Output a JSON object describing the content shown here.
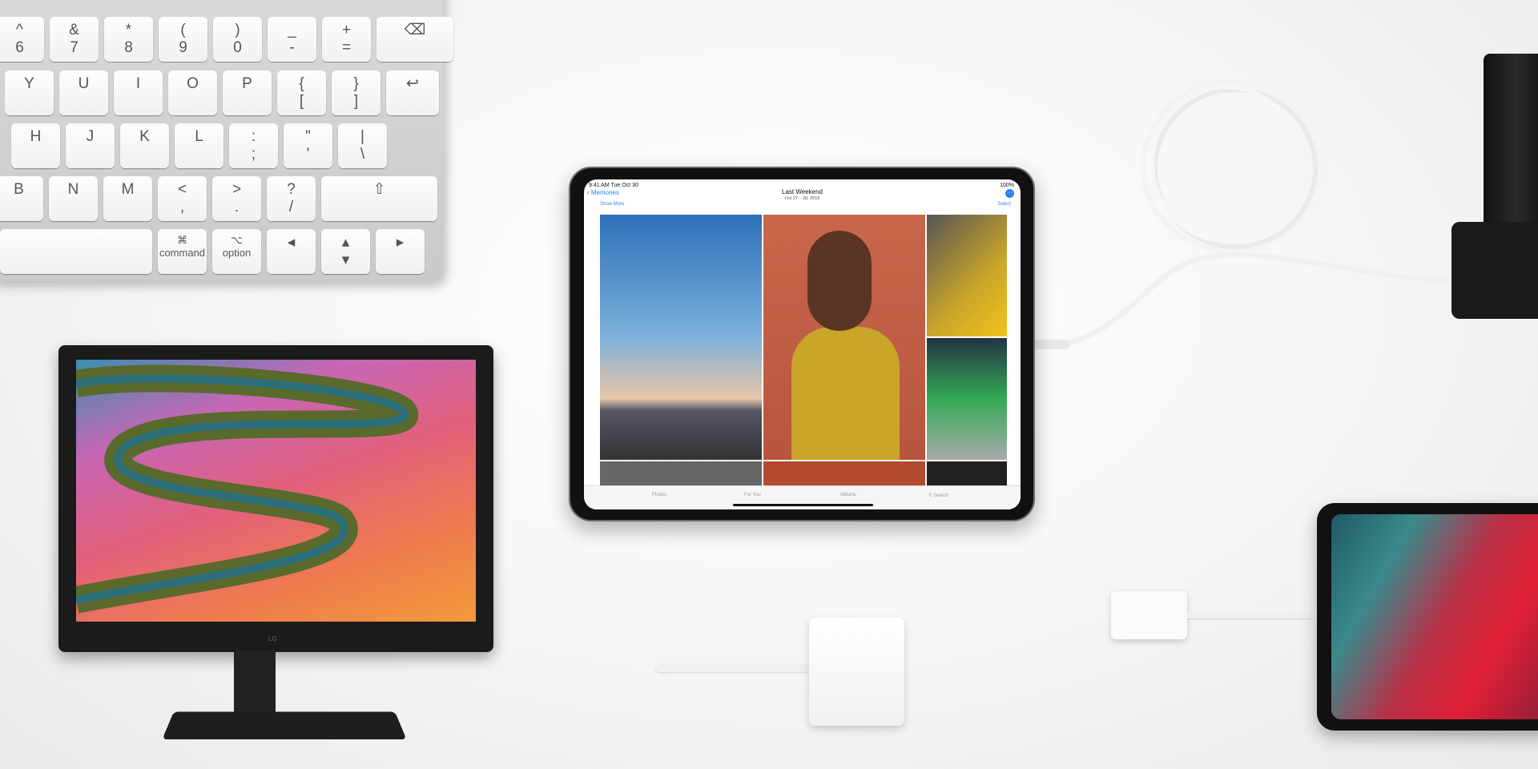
{
  "keyboard": {
    "rows": [
      [
        "^\n6",
        "&\n7",
        "*\n8",
        "(\n9",
        ")\n0",
        "_\n-",
        "+\n=",
        "⌫"
      ],
      [
        "Y",
        "U",
        "I",
        "O",
        "P",
        "{\n[",
        "}\n]",
        "↩"
      ],
      [
        "H",
        "J",
        "K",
        "L",
        ":\n;",
        "\"\n'",
        "|\n\\"
      ],
      [
        "B",
        "N",
        "M",
        "<\n,",
        ">\n.",
        "?\n/",
        "⇧"
      ],
      [
        "",
        "⌘\ncommand",
        "⌥\noption",
        "◂",
        "▴\n▾",
        "▸"
      ]
    ]
  },
  "monitor": {
    "brand": "LG"
  },
  "ipad": {
    "status_time": "9:41 AM  Tue Oct 30",
    "status_battery": "100%",
    "back_label": "Memories",
    "title": "Last Weekend",
    "subtitle": "Oct 27 – 28, 2018",
    "show_more": "Show More",
    "select": "Select",
    "tabs": [
      {
        "label": "Photos",
        "active": false
      },
      {
        "label": "For You",
        "active": true
      },
      {
        "label": "Albums",
        "active": false
      },
      {
        "label": "Search",
        "active": false
      }
    ],
    "accent": "#2f7ef6"
  }
}
